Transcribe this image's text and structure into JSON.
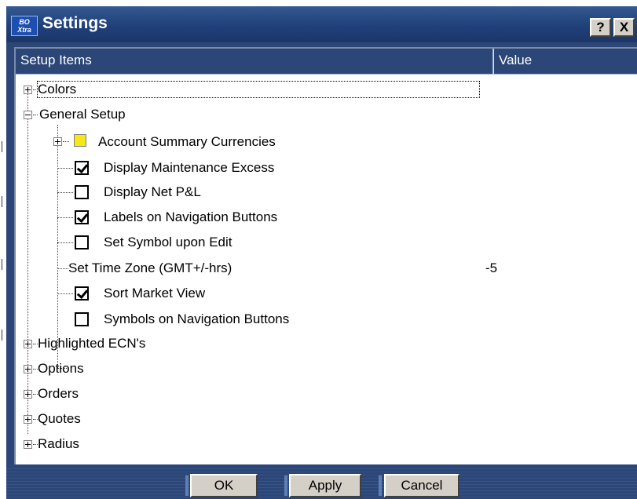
{
  "window": {
    "title": "Settings",
    "app_icon_text": "BO\nXtra",
    "help_label": "?",
    "close_label": "X"
  },
  "columns": {
    "items": "Setup Items",
    "value": "Value"
  },
  "tree": {
    "colors": "Colors",
    "general_setup": "General Setup",
    "account_summary_currencies": "Account Summary Currencies",
    "display_maintenance_excess": "Display Maintenance Excess",
    "display_maintenance_excess_checked": true,
    "display_net_pl": "Display Net P&L",
    "display_net_pl_checked": false,
    "labels_on_navigation_buttons": "Labels on Navigation Buttons",
    "labels_on_navigation_buttons_checked": true,
    "set_symbol_upon_edit": "Set Symbol upon Edit",
    "set_symbol_upon_edit_checked": false,
    "set_time_zone": "Set Time Zone (GMT+/-hrs)",
    "set_time_zone_value": "-5",
    "sort_market_view": "Sort Market View",
    "sort_market_view_checked": true,
    "symbols_on_navigation_buttons": "Symbols on Navigation Buttons",
    "symbols_on_navigation_buttons_checked": false,
    "highlighted_ecns": "Highlighted ECN's",
    "options": "Options",
    "orders": "Orders",
    "quotes": "Quotes",
    "radius": "Radius"
  },
  "buttons": {
    "ok": "OK",
    "apply": "Apply",
    "cancel": "Cancel"
  },
  "colors": {
    "titlebar": "#20407a",
    "header": "#2b4677",
    "currency_swatch": "#f6e71a"
  }
}
